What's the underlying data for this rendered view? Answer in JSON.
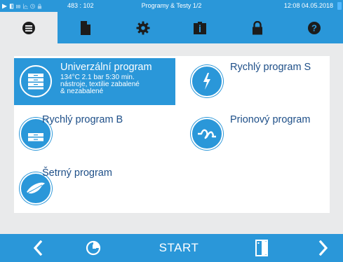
{
  "statusbar": {
    "value": "483 : 102",
    "title": "Programy & Testy 1/2",
    "time": "12:08  04.05.2018",
    "icons": [
      "play-icon",
      "door-icon",
      "steam-icon",
      "chart-icon",
      "clock-icon",
      "lock-icon"
    ]
  },
  "tabs": [
    {
      "icon": "list-icon",
      "active": true
    },
    {
      "icon": "document-icon",
      "active": false
    },
    {
      "icon": "gear-icon",
      "active": false
    },
    {
      "icon": "clipboard-info-icon",
      "active": false
    },
    {
      "icon": "lock-icon",
      "active": false
    },
    {
      "icon": "help-icon",
      "active": false
    }
  ],
  "programs": [
    {
      "name": "Univerzální program",
      "desc1": "134°C 2.1 bar 5:30 min.",
      "desc2": "nástroje, textilie zabalené",
      "desc3": "& nezabalené",
      "icon": "stack-icon",
      "selected": true
    },
    {
      "name": "Rychlý program S",
      "icon": "lightning-icon",
      "selected": false
    },
    {
      "name": "Rychlý program B",
      "icon": "tray-icon",
      "selected": false
    },
    {
      "name": "Prionový program",
      "icon": "prion-icon",
      "selected": false
    },
    {
      "name": "Šetrný program",
      "icon": "feather-icon",
      "selected": false
    }
  ],
  "bottombar": {
    "start_label": "START",
    "icons": [
      "chevron-left-icon",
      "timer-icon",
      "door-open-icon",
      "chevron-right-icon"
    ]
  },
  "colors": {
    "accent": "#2a97d9",
    "background": "#e9eaeb",
    "label": "#1e4f88"
  }
}
